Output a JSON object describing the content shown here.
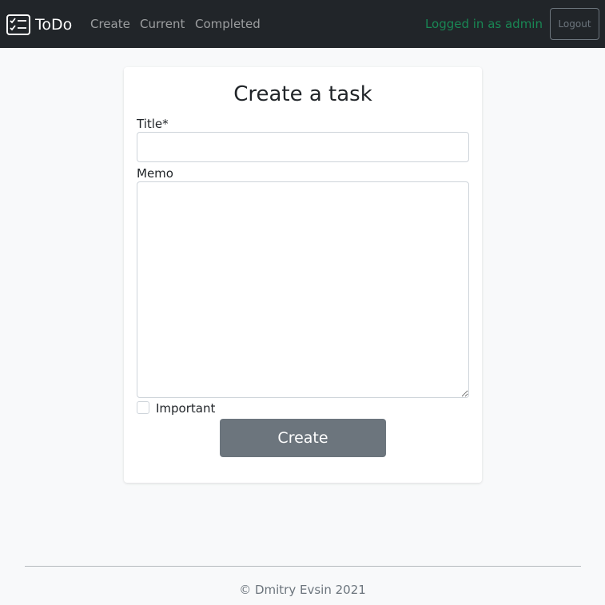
{
  "navbar": {
    "brand": "ToDo",
    "brand_icon": "checklist-icon",
    "links": [
      "Create",
      "Current",
      "Completed"
    ],
    "user_status": "Logged in as admin",
    "logout_label": "Logout"
  },
  "form": {
    "title": "Create a task",
    "title_label": "Title*",
    "title_value": "",
    "memo_label": "Memo",
    "memo_value": "",
    "important_label": "Important",
    "important_checked": false,
    "submit_label": "Create"
  },
  "footer": {
    "text": "© Dmitry Evsin 2021"
  },
  "colors": {
    "navbar_bg": "#212529",
    "page_bg": "#f8f9fa",
    "success": "#198754",
    "secondary": "#6c757d"
  }
}
